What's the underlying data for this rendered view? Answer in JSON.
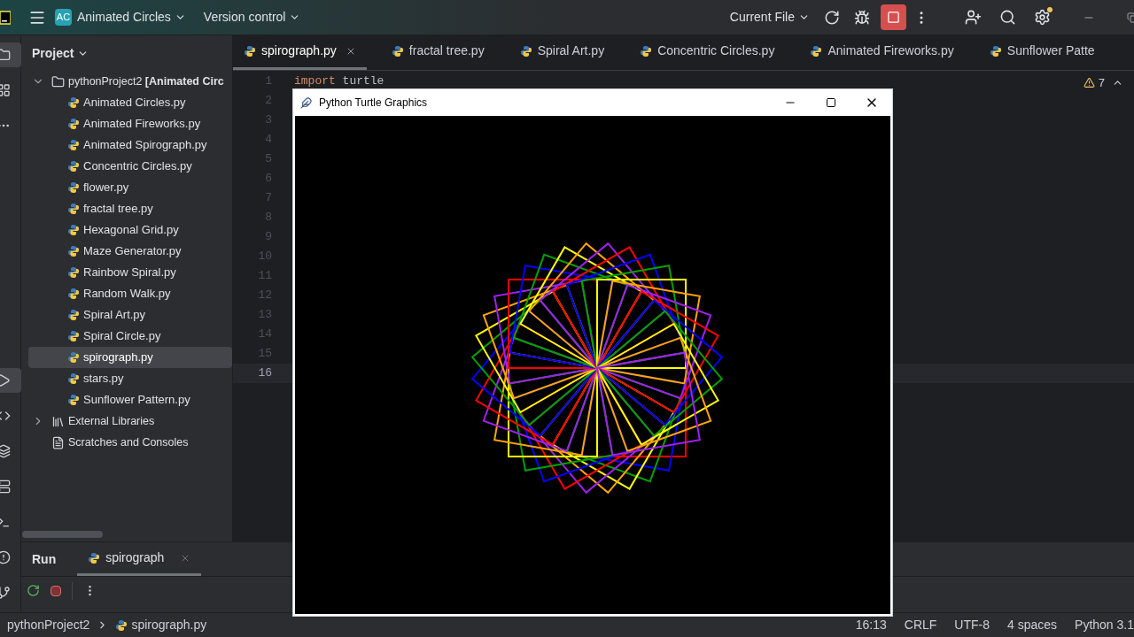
{
  "header": {
    "project_badge": "AC",
    "project_name": "Animated Circles",
    "vcs": "Version control",
    "run_config": "Current File"
  },
  "project_panel": {
    "title": "Project",
    "tree": [
      {
        "kind": "folder",
        "label": "pythonProject2 **[Animated Circ**",
        "expanded": true,
        "children": [
          {
            "label": "Animated Circles.py",
            "selected": false
          },
          {
            "label": "Animated Fireworks.py",
            "selected": false
          },
          {
            "label": "Animated Spirograph.py",
            "selected": false
          },
          {
            "label": "Concentric Circles.py",
            "selected": false
          },
          {
            "label": "flower.py",
            "selected": false
          },
          {
            "label": "fractal tree.py",
            "selected": false
          },
          {
            "label": "Hexagonal Grid.py",
            "selected": false
          },
          {
            "label": "Maze Generator.py",
            "selected": false
          },
          {
            "label": "Rainbow Spiral.py",
            "selected": false
          },
          {
            "label": "Random Walk.py",
            "selected": false
          },
          {
            "label": "Spiral Art.py",
            "selected": false
          },
          {
            "label": "Spiral Circle.py",
            "selected": false
          },
          {
            "label": "spirograph.py",
            "selected": true
          },
          {
            "label": "stars.py",
            "selected": false
          },
          {
            "label": "Sunflower Pattern.py",
            "selected": false
          }
        ]
      },
      {
        "kind": "libraries",
        "label": "External Libraries",
        "expanded": false
      },
      {
        "kind": "scratches",
        "label": "Scratches and Consoles"
      }
    ]
  },
  "editor_tabs": [
    {
      "label": "spirograph.py",
      "selected": true
    },
    {
      "label": "fractal tree.py",
      "selected": false
    },
    {
      "label": "Spiral Art.py",
      "selected": false
    },
    {
      "label": "Concentric Circles.py",
      "selected": false
    },
    {
      "label": "Animated Fireworks.py",
      "selected": false
    },
    {
      "label": "Sunflower Patte",
      "selected": false
    }
  ],
  "editor": {
    "warnings": "7",
    "lines": [
      {
        "number": "1",
        "current": false,
        "code": [
          {
            "kind": "keyword",
            "text": "import"
          },
          {
            "kind": "name",
            "text": "turtle"
          }
        ]
      },
      {
        "number": "2",
        "current": false
      },
      {
        "number": "3",
        "current": false
      },
      {
        "number": "4",
        "current": false
      },
      {
        "number": "5",
        "current": false
      },
      {
        "number": "6",
        "current": false
      },
      {
        "number": "7",
        "current": false
      },
      {
        "number": "8",
        "current": false
      },
      {
        "number": "9",
        "current": false
      },
      {
        "number": "10",
        "current": false
      },
      {
        "number": "11",
        "current": false
      },
      {
        "number": "12",
        "current": false
      },
      {
        "number": "13",
        "current": false
      },
      {
        "number": "14",
        "current": false
      },
      {
        "number": "15",
        "current": false
      },
      {
        "number": "16",
        "current": true
      }
    ]
  },
  "turtle_window": {
    "title": "Python Turtle Graphics"
  },
  "run_panel": {
    "title": "Run",
    "tabs": [
      {
        "label": "spirograph",
        "selected": true
      }
    ]
  },
  "breadcrumbs": [
    "pythonProject2",
    "spirograph.py"
  ],
  "status_bar": [
    "16:13",
    "CRLF",
    "UTF-8",
    "4 spaces",
    "Python 3.1"
  ]
}
